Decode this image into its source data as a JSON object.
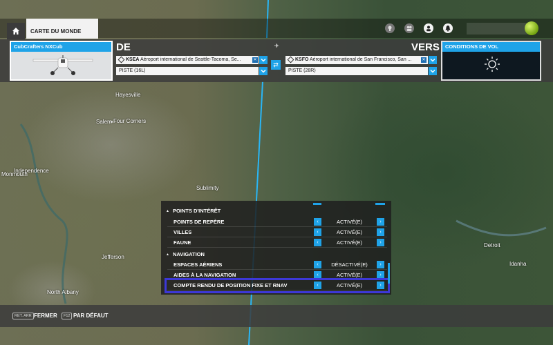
{
  "top_bar": {
    "tab_label": "CARTE DU MONDE",
    "icons": [
      "home-icon",
      "achievements-icon",
      "friends-icon",
      "profile-icon",
      "notification-icon"
    ]
  },
  "flight": {
    "aircraft": {
      "name": "CubCrafters NXCub"
    },
    "departure": {
      "header": "DE",
      "airport_code": "KSEA",
      "airport_name": "Aéroport international de Seattle-Tacoma, Se...",
      "runway": "PISTE (16L)"
    },
    "arrival": {
      "header": "VERS",
      "airport_code": "KSFO",
      "airport_name": "Aéroport international de San Francisco, San ...",
      "runway": "PISTE (28R)"
    },
    "conditions": {
      "title": "CONDITIONS DE VOL",
      "icon": "sun-icon"
    }
  },
  "map": {
    "labels": [
      "Hayesville",
      "Salem",
      "Four Corners",
      "Independence",
      "Monmouth",
      "Sublimity",
      "Jefferson",
      "North Albany",
      "Detroit",
      "Idanha"
    ],
    "route_color": "#29b6f6"
  },
  "options": {
    "sections": [
      {
        "title": "POINTS D'INTÉRÊT",
        "rows": [
          {
            "label": "POINTS DE REPÈRE",
            "value": "ACTIVÉ(E)"
          },
          {
            "label": "VILLES",
            "value": "ACTIVÉ(E)"
          },
          {
            "label": "FAUNE",
            "value": "ACTIVÉ(E)"
          }
        ]
      },
      {
        "title": "NAVIGATION",
        "rows": [
          {
            "label": "ESPACES AÉRIENS",
            "value": "DÉSACTIVÉ(E)"
          },
          {
            "label": "AIDES À LA NAVIGATION",
            "value": "ACTIVÉ(E)"
          },
          {
            "label": "COMPTE RENDU DE POSITION FIXE ET RNAV",
            "value": "ACTIVÉ(E)"
          }
        ]
      }
    ],
    "selected_row": "COMPTE RENDU DE POSITION FIXE ET RNAV"
  },
  "bottom_bar": {
    "close_key": "RET. ARR",
    "close_label": "FERMER",
    "default_key": "F12",
    "default_label": "PAR DÉFAUT"
  },
  "colors": {
    "accent": "#1fa3e8",
    "selection": "#3d38d6"
  }
}
